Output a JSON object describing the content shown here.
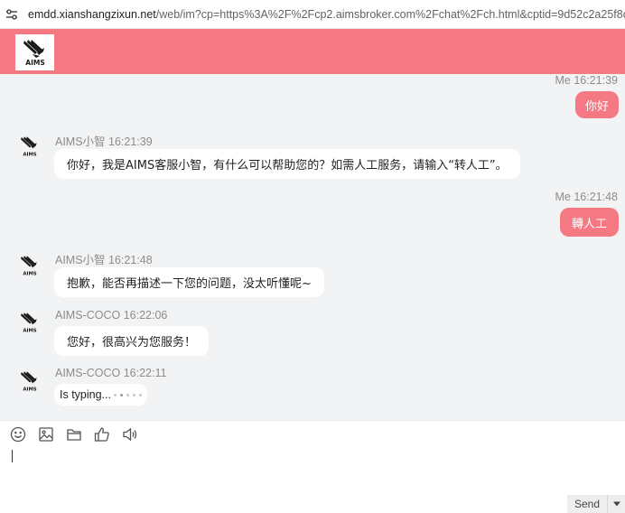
{
  "browser": {
    "url_host": "emdd.xianshangzixun.net",
    "url_path": "/web/im?cp=https%3A%2F%2Fcp2.aimsbroker.com%2Fchat%2Fch.html&cptid=9d52c2a25f8c..."
  },
  "header": {
    "logo_text": "AIMS",
    "accent_color": "#f47983"
  },
  "messages": [
    {
      "sender": "Me",
      "time": "16:21:39",
      "meta": "Me 16:21:39",
      "text": "你好",
      "side": "right"
    },
    {
      "sender": "AIMS小智",
      "time": "16:21:39",
      "meta": "AIMS小智 16:21:39",
      "text": "你好，我是AIMS客服小智，有什么可以帮助您的？如需人工服务，请输入“转人工”。",
      "side": "left"
    },
    {
      "sender": "Me",
      "time": "16:21:48",
      "meta": "Me 16:21:48",
      "text": "轉人工",
      "side": "right"
    },
    {
      "sender": "AIMS小智",
      "time": "16:21:48",
      "meta": "AIMS小智 16:21:48",
      "text": "抱歉，能否再描述一下您的问题，没太听懂呢~",
      "side": "left"
    },
    {
      "sender": "AIMS-COCO",
      "time": "16:22:06",
      "meta": "AIMS-COCO 16:22:06",
      "text": "您好，很高兴为您服务！",
      "side": "left"
    },
    {
      "sender": "AIMS-COCO",
      "time": "16:22:11",
      "meta": "AIMS-COCO 16:22:11",
      "text": "Is typing...",
      "side": "left"
    }
  ],
  "toolbar": {
    "icons": [
      "smiley-icon",
      "image-icon",
      "folder-icon",
      "thumbs-up-icon",
      "speaker-icon"
    ]
  },
  "composer": {
    "value": "",
    "send_label": "Send"
  }
}
